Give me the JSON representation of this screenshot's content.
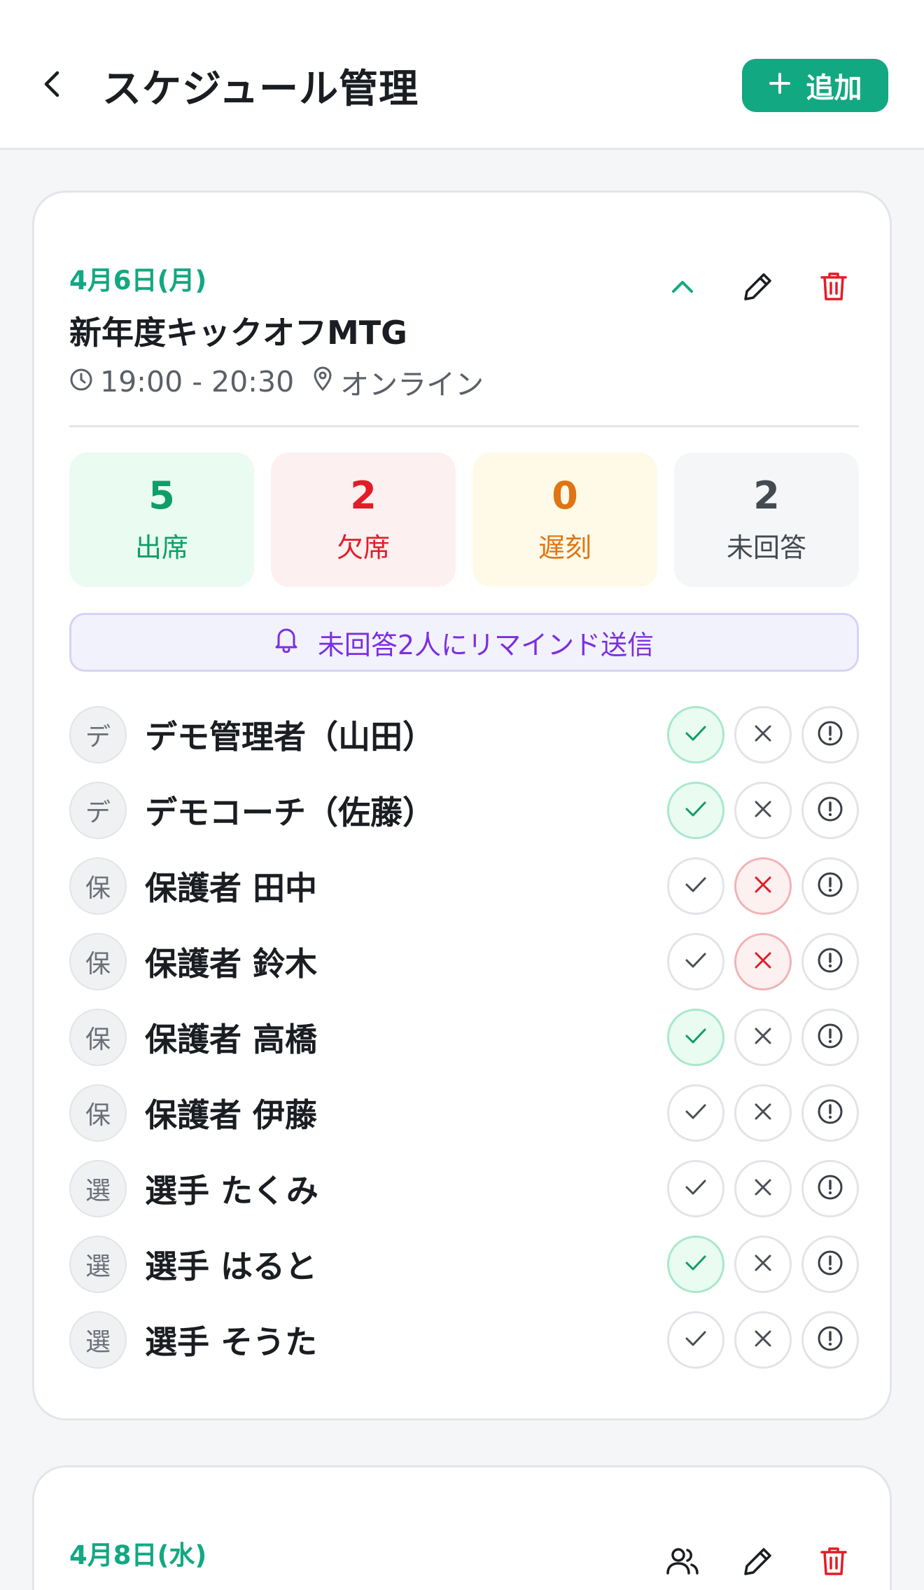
{
  "header": {
    "title": "スケジュール管理",
    "add_label": "追加"
  },
  "colors": {
    "accent": "#12a882",
    "danger": "#e11d27",
    "late": "#e07414",
    "remind": "#7c2fe0"
  },
  "events": [
    {
      "date": "4月6日(月)",
      "title": "新年度キックオフMTG",
      "time": "19:00 - 20:30",
      "location": "オンライン",
      "expanded": true,
      "stats": [
        {
          "value": "5",
          "label": "出席"
        },
        {
          "value": "2",
          "label": "欠席"
        },
        {
          "value": "0",
          "label": "遅刻"
        },
        {
          "value": "2",
          "label": "未回答"
        }
      ],
      "remind_label": "未回答2人にリマインド送信",
      "members": [
        {
          "initial": "デ",
          "name": "デモ管理者（山田）",
          "status": "present"
        },
        {
          "initial": "デ",
          "name": "デモコーチ（佐藤）",
          "status": "present"
        },
        {
          "initial": "保",
          "name": "保護者 田中",
          "status": "absent"
        },
        {
          "initial": "保",
          "name": "保護者 鈴木",
          "status": "absent"
        },
        {
          "initial": "保",
          "name": "保護者 高橋",
          "status": "present"
        },
        {
          "initial": "保",
          "name": "保護者 伊藤",
          "status": "none"
        },
        {
          "initial": "選",
          "name": "選手 たくみ",
          "status": "none"
        },
        {
          "initial": "選",
          "name": "選手 はると",
          "status": "present"
        },
        {
          "initial": "選",
          "name": "選手 そうた",
          "status": "none"
        }
      ]
    },
    {
      "date": "4月8日(水)",
      "title": "",
      "expanded": false
    }
  ],
  "icons": {
    "back": "chevron-left-icon",
    "add": "plus-icon",
    "collapse": "chevron-up-icon",
    "edit": "pencil-icon",
    "delete": "trash-icon",
    "time": "clock-icon",
    "location": "map-pin-icon",
    "remind": "bell-icon",
    "attendees": "users-icon",
    "present": "check-icon",
    "absent": "x-icon",
    "late": "alert-circle-icon"
  }
}
